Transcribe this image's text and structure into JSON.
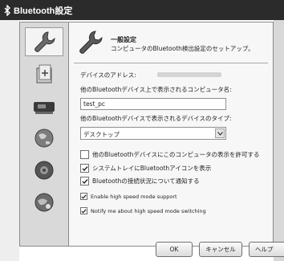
{
  "window": {
    "title": "Bluetooth設定"
  },
  "sidebar": {
    "tabs": [
      {
        "icon": "wrench-icon",
        "selected": true
      },
      {
        "icon": "folder-transfer-icon",
        "selected": false
      },
      {
        "icon": "hardware-device-icon",
        "selected": false
      },
      {
        "icon": "globe-network-icon",
        "selected": false
      },
      {
        "icon": "speaker-icon",
        "selected": false
      },
      {
        "icon": "globe-dialup-icon",
        "selected": false
      }
    ]
  },
  "header": {
    "icon": "wrench-icon",
    "title": "一般設定",
    "subtitle": "コンピュータのBluetooth検出設定のセットアップ。"
  },
  "form": {
    "address_label": "デバイスのアドレス:",
    "computer_name_label": "他のBluetoothデバイス上で表示されるコンピュータ名:",
    "computer_name_value": "test_pc",
    "device_type_label": "他のBluetoothデバイスで表示されるデバイスのタイプ:",
    "device_type_value": "デスクトップ"
  },
  "checkboxes": [
    {
      "label": "他のBluetoothデバイスにこのコンピュータの表示を許可する",
      "checked": false
    },
    {
      "label": "システムトレイにBluetoothアイコンを表示",
      "checked": true
    },
    {
      "label": "Bluetoothの接続状況について通知する",
      "checked": true
    },
    {
      "label": "Enable high speed mode support",
      "checked": true
    },
    {
      "label": "Notify me about high speed mode switching",
      "checked": true
    }
  ],
  "buttons": {
    "ok": "OK",
    "cancel": "キャンセル",
    "help": "ヘルプ"
  },
  "colors": {
    "titlebar": "#2b2b2b",
    "panel": "#f7f7f7",
    "sidebar": "#d9d9d9"
  }
}
